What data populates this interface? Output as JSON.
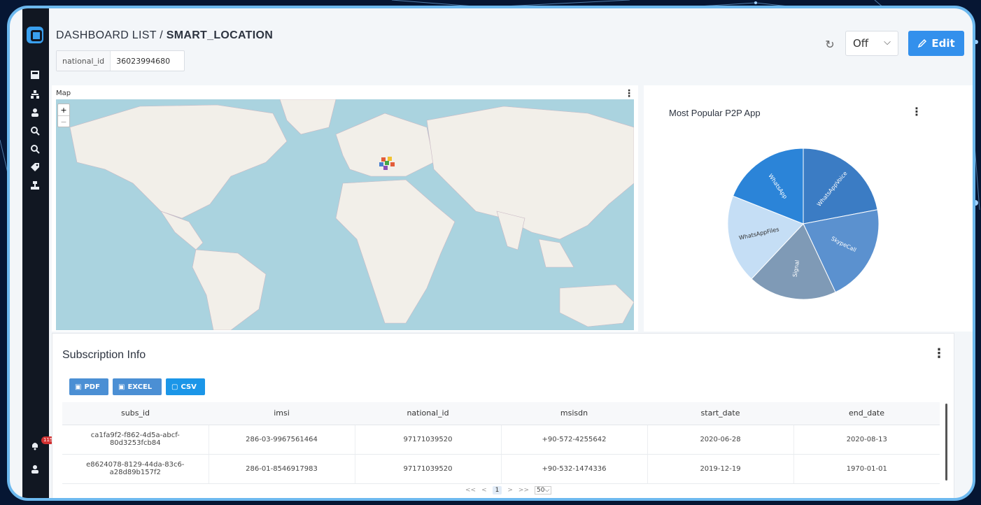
{
  "header": {
    "breadcrumb_parent": "DASHBOARD LIST / ",
    "breadcrumb_current": "SMART_LOCATION",
    "filter_key": "national_id",
    "filter_value": "36023994680",
    "refresh_select": "Off",
    "edit_label": "Edit"
  },
  "sidebar": {
    "icons": [
      "dashboard-icon",
      "hierarchy-icon",
      "user-icon",
      "zoom-search-icon",
      "search-icon",
      "tag-icon",
      "network-icon"
    ],
    "notification_count": "115",
    "bottom_icons": [
      "notification-icon",
      "profile-icon"
    ]
  },
  "map": {
    "title": "Map",
    "zoom_in": "+",
    "zoom_out": "−"
  },
  "pie": {
    "title": "Most Popular P2P App"
  },
  "chart_data": {
    "type": "pie",
    "title": "Most Popular P2P App",
    "categories": [
      "WhatsAppVoice",
      "SkypeCall",
      "Signal",
      "WhatsAppFiles",
      "WhatsApp"
    ],
    "values": [
      22,
      21,
      19,
      19,
      19
    ],
    "colors": [
      "#3b7cc4",
      "#5b91cf",
      "#7f9ab6",
      "#c5def5",
      "#2b84d8"
    ],
    "legend": "none"
  },
  "subscription": {
    "title": "Subscription Info",
    "export_buttons": [
      "PDF",
      "EXCEL",
      "CSV"
    ],
    "columns": [
      "subs_id",
      "imsi",
      "national_id",
      "msisdn",
      "start_date",
      "end_date"
    ],
    "rows": [
      [
        "ca1fa9f2-f862-4d5a-abcf-80d3253fcb84",
        "286-03-9967561464",
        "97171039520",
        "+90-572-4255642",
        "2020-06-28",
        "2020-08-13"
      ],
      [
        "e8624078-8129-44da-83c6-a28d89b157f2",
        "286-01-8546917983",
        "97171039520",
        "+90-532-1474336",
        "2019-12-19",
        "1970-01-01"
      ]
    ],
    "pager": {
      "first": "<<",
      "prev": "<",
      "current_page": "1",
      "next": ">",
      "last": ">>",
      "page_size": "50"
    }
  }
}
